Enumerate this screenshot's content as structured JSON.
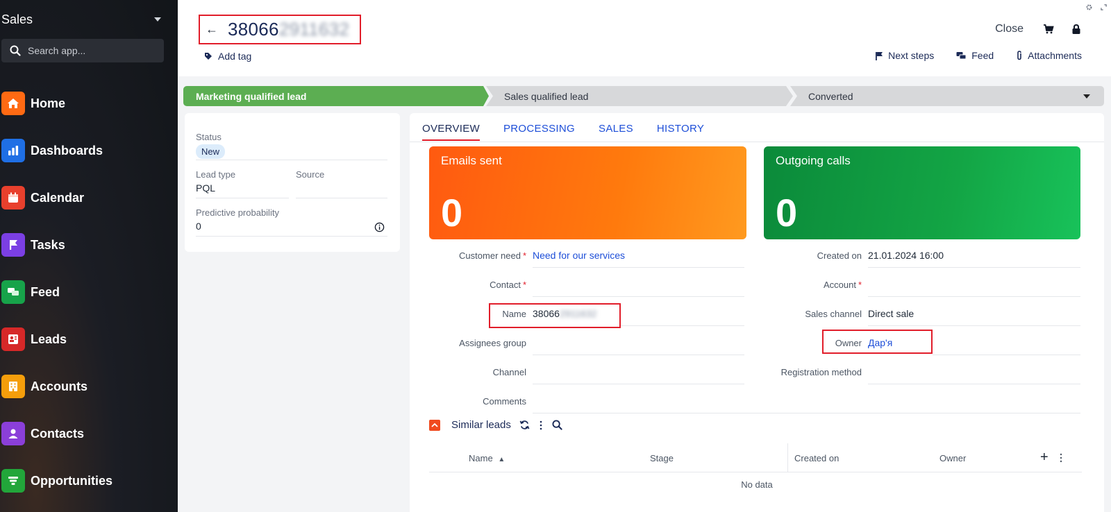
{
  "sidebar": {
    "title": "Sales",
    "search_placeholder": "Search app...",
    "items": [
      {
        "label": "Home",
        "icon": "home-icon",
        "color": "#ff6a13"
      },
      {
        "label": "Dashboards",
        "icon": "bar-chart-icon",
        "color": "#1f6fe5"
      },
      {
        "label": "Calendar",
        "icon": "calendar-icon",
        "color": "#e8402d"
      },
      {
        "label": "Tasks",
        "icon": "flag-icon",
        "color": "#7b3fe4"
      },
      {
        "label": "Feed",
        "icon": "chat-bubbles-icon",
        "color": "#17a34a"
      },
      {
        "label": "Leads",
        "icon": "leads-icon",
        "color": "#d62828"
      },
      {
        "label": "Accounts",
        "icon": "building-icon",
        "color": "#f59e0b"
      },
      {
        "label": "Contacts",
        "icon": "person-icon",
        "color": "#8b3fd9"
      },
      {
        "label": "Opportunities",
        "icon": "funnel-icon",
        "color": "#22a63a"
      }
    ]
  },
  "header": {
    "title_visible": "38066",
    "title_blurred": "2911632",
    "add_tag": "Add tag",
    "close": "Close",
    "actions": [
      "Next steps",
      "Feed",
      "Attachments"
    ]
  },
  "stages": [
    "Marketing qualified lead",
    "Sales qualified lead",
    "Converted"
  ],
  "left_card": {
    "status_label": "Status",
    "status_value": "New",
    "lead_type_label": "Lead type",
    "lead_type_value": "PQL",
    "source_label": "Source",
    "source_value": "",
    "probability_label": "Predictive probability",
    "probability_value": "0"
  },
  "tabs": [
    "OVERVIEW",
    "PROCESSING",
    "SALES",
    "HISTORY"
  ],
  "tiles": {
    "emails_title": "Emails sent",
    "emails_value": "0",
    "calls_title": "Outgoing calls",
    "calls_value": "0"
  },
  "form_left": {
    "customer_need_label": "Customer need",
    "customer_need_value": "Need for our services",
    "contact_label": "Contact",
    "name_label": "Name",
    "name_visible": "38066",
    "name_blurred": "2911632",
    "assignees_label": "Assignees group",
    "channel_label": "Channel",
    "comments_label": "Comments"
  },
  "form_right": {
    "created_label": "Created on",
    "created_value": "21.01.2024 16:00",
    "account_label": "Account",
    "sales_channel_label": "Sales channel",
    "sales_channel_value": "Direct sale",
    "owner_label": "Owner",
    "owner_value": "Дар'я",
    "registration_label": "Registration method"
  },
  "similar": {
    "title": "Similar leads",
    "columns": [
      "Name",
      "Stage",
      "Created on",
      "Owner"
    ],
    "empty": "No data"
  }
}
